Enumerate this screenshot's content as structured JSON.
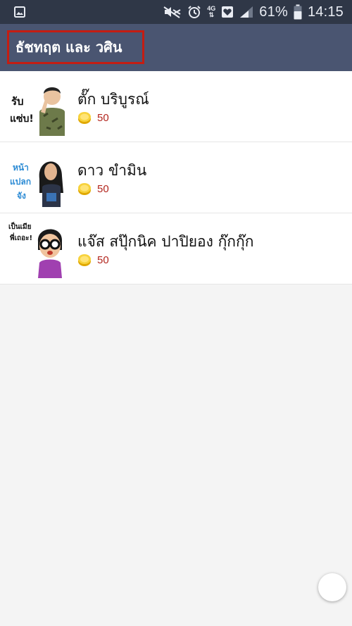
{
  "status_bar": {
    "network_label_top": "4G",
    "battery": "61%",
    "time": "14:15"
  },
  "app_bar": {
    "title": "ธัชทฤต และ วศิน"
  },
  "items": [
    {
      "name": "ตั๊ก บริบูรณ์",
      "price": "50",
      "thumb_text": [
        "รับ",
        "แซ่บ!"
      ]
    },
    {
      "name": "ดาว ขำมิน",
      "price": "50",
      "thumb_text": [
        "หน้า",
        "แปลก",
        "จัง"
      ]
    },
    {
      "name": "แจ๊ส สปุ๊กนิค ปาปิยอง กุ๊กกุ๊ก",
      "price": "50",
      "thumb_text": [
        "เป็นเมีย",
        "พี่เถอะ!"
      ]
    }
  ],
  "colors": {
    "status_bar": "#2f3747",
    "app_bar": "#4a5571",
    "highlight": "#c41d12",
    "price": "#b3261e"
  },
  "icons": [
    "image-icon",
    "mute-icon",
    "alarm-icon",
    "favorite-box-icon",
    "signal-icon",
    "battery-icon",
    "coin-icon"
  ]
}
